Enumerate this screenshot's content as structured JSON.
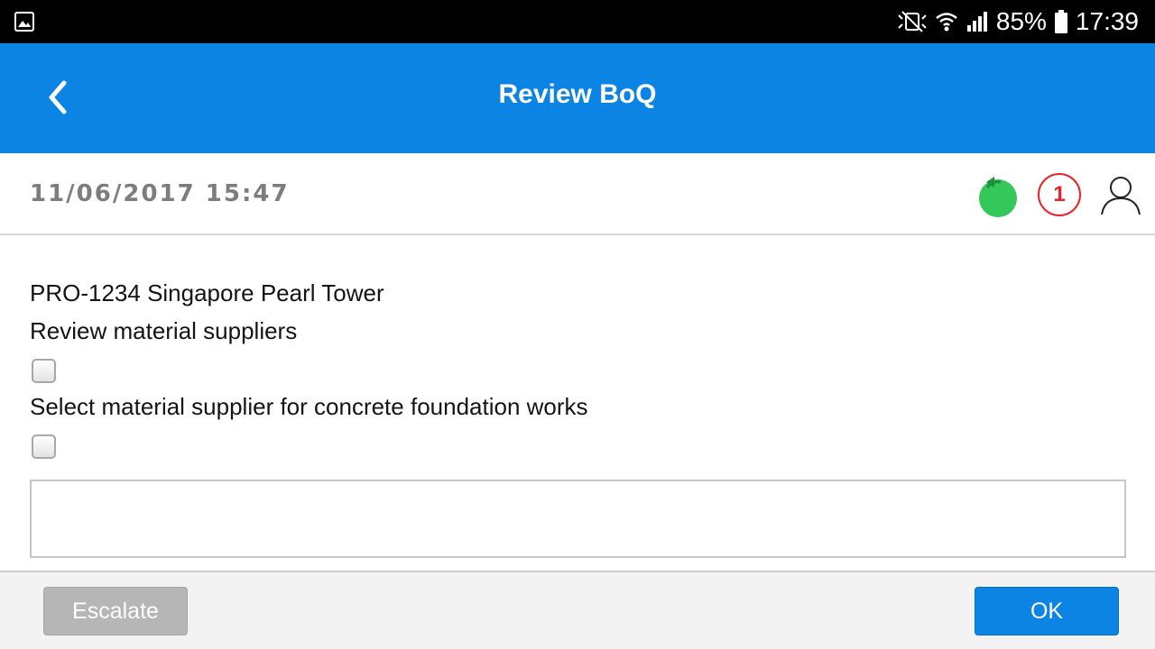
{
  "status_bar": {
    "battery": "85%",
    "time": "17:39",
    "icons": [
      "gallery-icon",
      "mute-icon",
      "wifi-icon",
      "signal-icon",
      "battery-icon"
    ]
  },
  "app_bar": {
    "title": "Review BoQ",
    "back_icon": "chevron-left-icon",
    "color": "#0b84e3"
  },
  "info": {
    "timestamp": "11/06/2017 15:47",
    "badge_count": "1",
    "icons": [
      "green-undo-icon",
      "count-badge",
      "user-icon"
    ]
  },
  "task": {
    "project": "PRO-1234 Singapore Pearl Tower",
    "items": [
      {
        "label": "Review material suppliers",
        "checked": false
      },
      {
        "label": "Select material supplier for concrete foundation works",
        "checked": false
      }
    ],
    "notes_value": ""
  },
  "actions": {
    "escalate_label": "Escalate",
    "ok_label": "OK"
  }
}
